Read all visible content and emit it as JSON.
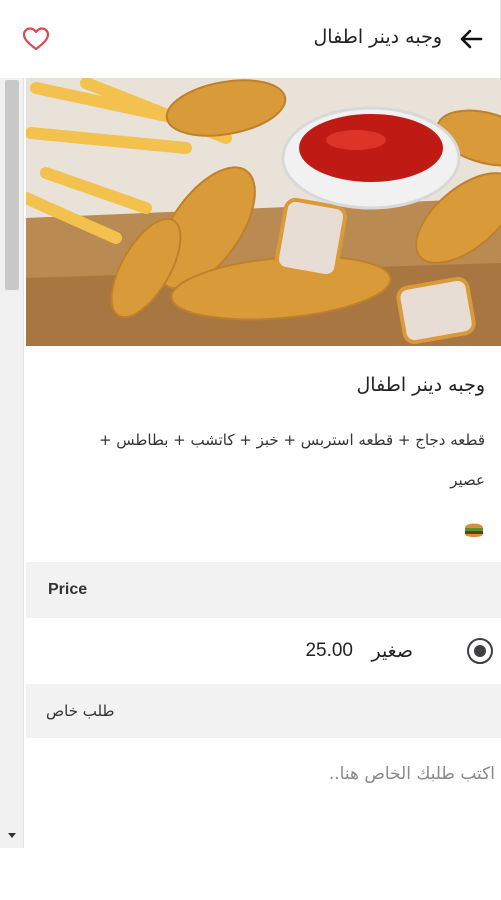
{
  "header": {
    "title": "وجبه دينر اطفال",
    "back_icon": "arrow-back-icon",
    "favorite_icon": "heart-outline-icon",
    "accent_color": "#e0464f"
  },
  "product": {
    "name": "وجبه دينر اطفال",
    "description": "قطعه دجاج + قطعه استربس + خبز + كاتشب + بطاطس + عصير",
    "image_icon": "chicken-strips-fries-photo",
    "dish_icon": "burger-icon"
  },
  "price_section": {
    "header": "Price",
    "options": [
      {
        "size": "صغير",
        "price": "25.00",
        "selected": true
      }
    ]
  },
  "special_request": {
    "header": "طلب خاص",
    "placeholder": "اكتب طلبك الخاص هنا..",
    "value": ""
  }
}
